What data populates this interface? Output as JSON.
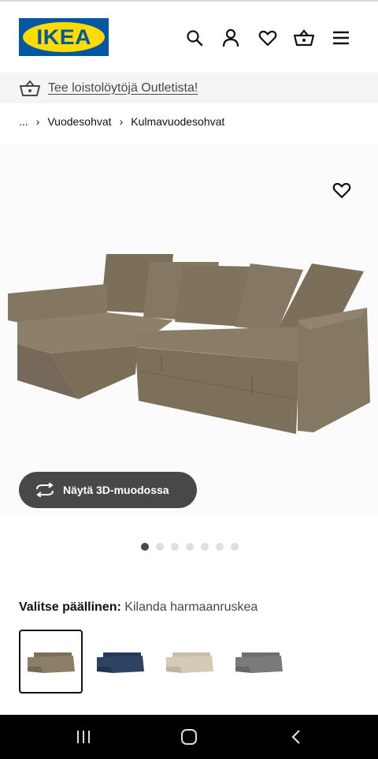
{
  "header": {
    "logo_text": "IKEA",
    "icons": [
      "search-icon",
      "user-icon",
      "heart-icon",
      "basket-icon",
      "menu-icon"
    ]
  },
  "promo": {
    "icon": "basket-icon",
    "text": "Tee loistolöytöjä Outletista!"
  },
  "breadcrumb": {
    "ellipsis": "...",
    "items": [
      "Vuodesohvat",
      "Kulmavuodesohvat"
    ]
  },
  "product_media": {
    "favorite_icon": "heart-icon",
    "view_3d_label": "Näytä 3D-muodossa",
    "view_3d_icon": "rotate-icon",
    "image_count": 7,
    "active_image": 1
  },
  "cover_selection": {
    "label": "Valitse päällinen:",
    "selected_value": "Kilanda harmaanruskea",
    "swatches": [
      {
        "color": "#8c7f68",
        "selected": true
      },
      {
        "color": "#2f4463",
        "selected": false
      },
      {
        "color": "#d3cbb6",
        "selected": false
      },
      {
        "color": "#7a7a7a",
        "selected": false
      }
    ]
  },
  "colors": {
    "brand_blue": "#0058a3",
    "brand_yellow": "#ffdb00",
    "button_dark": "#484848",
    "sofa": "#8c7f68"
  },
  "system_nav": {
    "icons": [
      "recent-apps-icon",
      "home-icon",
      "back-icon"
    ]
  }
}
